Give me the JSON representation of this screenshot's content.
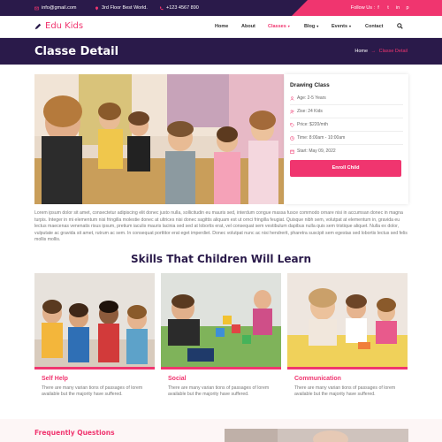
{
  "topbar": {
    "email": "info@gmail.com",
    "address": "3rd Floor Best World.",
    "phone": "+123 4567 890",
    "follow_label": "Follow Us :",
    "social": [
      "f",
      "t",
      "in",
      "p"
    ]
  },
  "nav": {
    "logo": "Edu Kids",
    "items": [
      {
        "label": "Home",
        "caret": ""
      },
      {
        "label": "About",
        "caret": ""
      },
      {
        "label": "Classes",
        "caret": "▾"
      },
      {
        "label": "Blog",
        "caret": "▾"
      },
      {
        "label": "Events",
        "caret": "▾"
      },
      {
        "label": "Contact",
        "caret": ""
      }
    ]
  },
  "header": {
    "title": "Classe Detail",
    "breadcrumb_home": "Home",
    "breadcrumb_sep": "→",
    "breadcrumb_current": "Classe Detail"
  },
  "card": {
    "title": "Drawing Class",
    "age": "Age: 2-5 Years",
    "size": "Zise: 24 Kids",
    "price": "Price: $220/mth",
    "time": "Time: 8:00am - 10:00am",
    "start": "Start: May 09, 2022",
    "enroll": "Enroll Child"
  },
  "description": "Lorem ipsum dolor sit amet, consectetur adipiscing elit donec justo nulla, sollicitudin eu mauris sed, interdum congue massa fusce commodo ornare nisi in accumsan donec in magna turpis. Integer in mi elementum nisi fringilla molestie donec at ultrices nisi donec sagittis aliquam est ut ornci fringilla feugiat. Quisque nibh sem, volutpat at elementum in, gravida eu lectus maecenas venenatis risus ipsum, pretium iaculis mauris lacinia sed sed at lobortis erat, vel consequat sem vestibulum dapibus nulla quis sem tristique aliquet. Nulla ex dolor, vulputate ac gravida sit amet, rutrum ac sem. In consequat porttitor erat eget imperdiet. Donec volutpat nunc ac nisi hendrerit, pharetra suscipit sem egestas sed lobortis lectus sed felis mollis mollis.",
  "skills": {
    "title": "Skills That Children Will Learn",
    "items": [
      {
        "title": "Self Help",
        "text": "There are many varian tions of passages of lorem available but the majority have suffered."
      },
      {
        "title": "Social",
        "text": "There are many varian tions of passages of lorem available but the majority have suffered."
      },
      {
        "title": "Communication",
        "text": "There are many varian tions of passages of lorem available but the majority have suffered."
      }
    ]
  },
  "faq": {
    "title": "Frequently Questions"
  },
  "colors": {
    "accent": "#f0356f",
    "dark": "#2a1a4a"
  }
}
